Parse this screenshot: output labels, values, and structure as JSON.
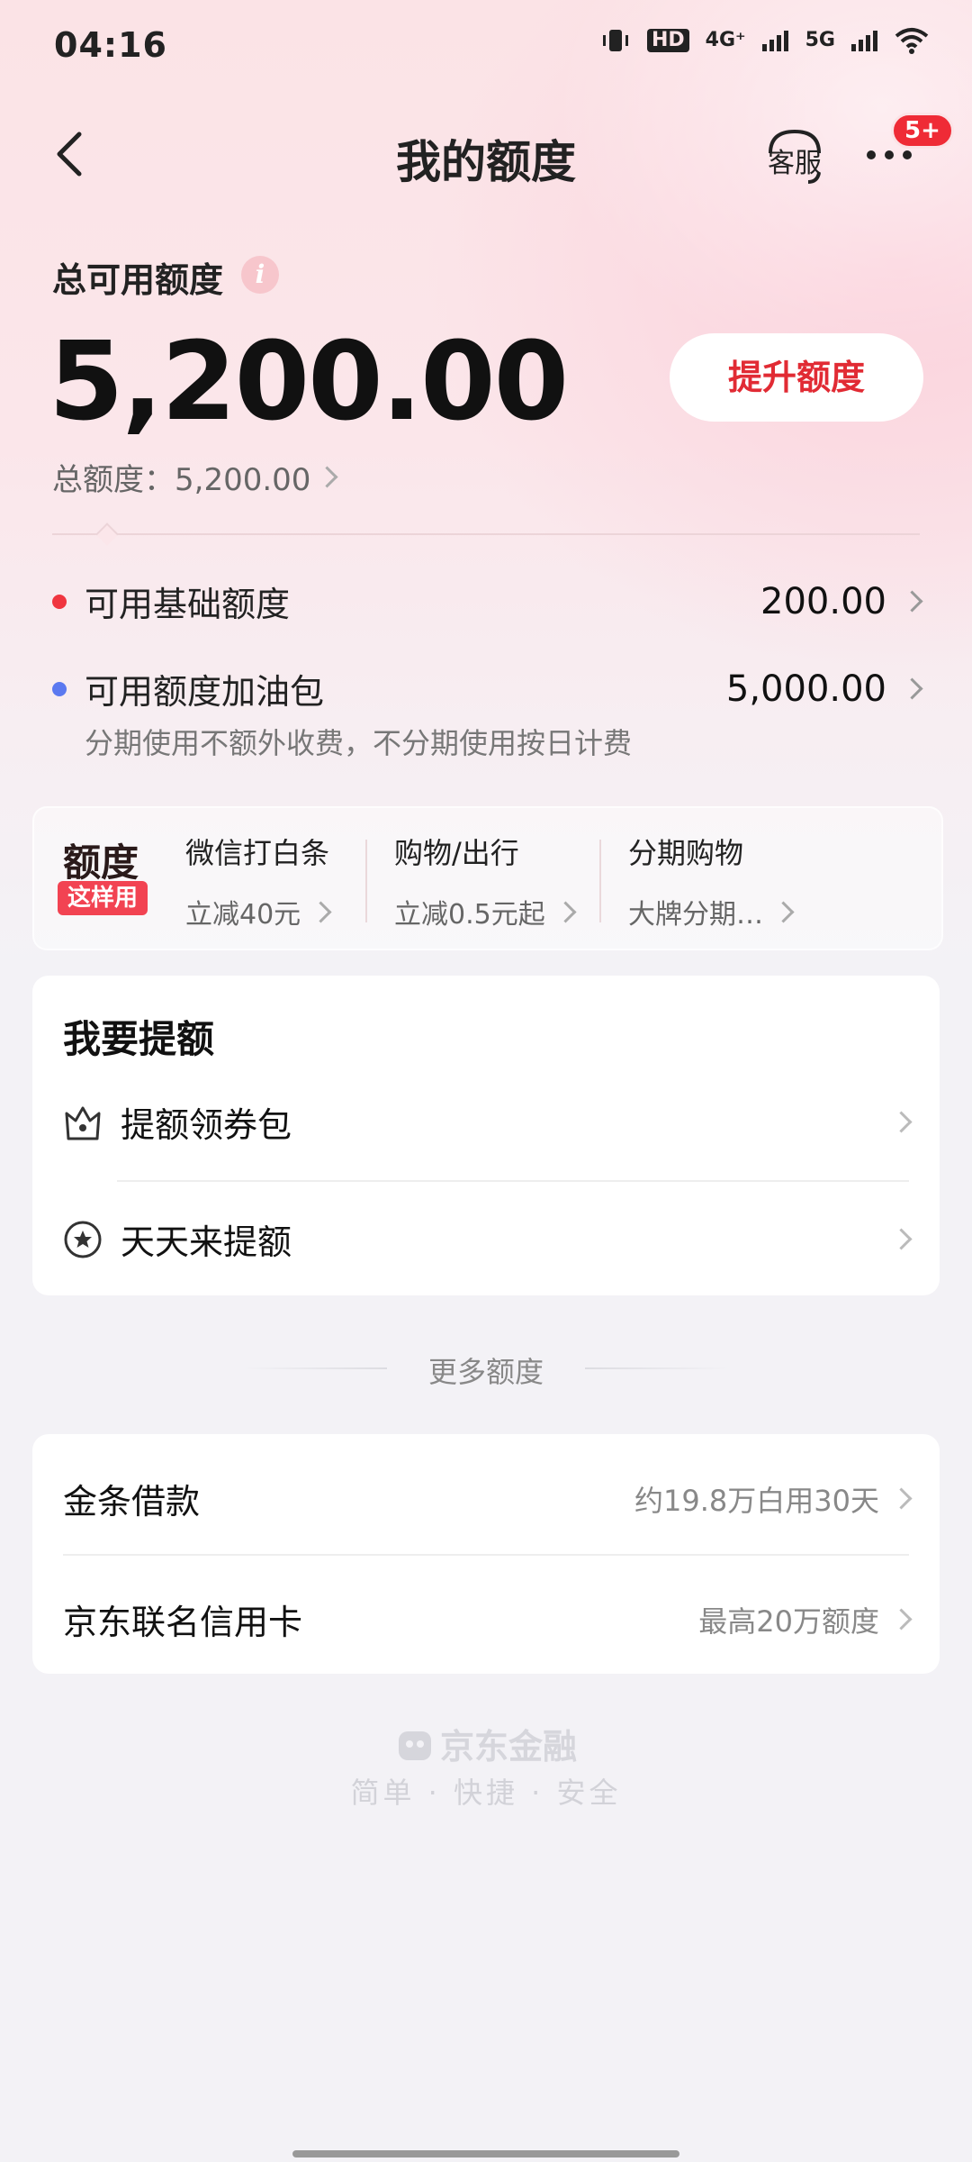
{
  "status_bar": {
    "time": "04:16",
    "hd_label": "HD",
    "net1": "4G⁺",
    "net2": "5G"
  },
  "nav": {
    "title": "我的额度",
    "service_label": "客服",
    "badge": "5+"
  },
  "summary": {
    "label": "总可用额度",
    "info_glyph": "i",
    "amount": "5,200.00",
    "raise_button": "提升额度",
    "total_text": "总额度：5,200.00"
  },
  "details": [
    {
      "label": "可用基础额度",
      "value": "200.00",
      "dot_color": "#f0353f"
    },
    {
      "label": "可用额度加油包",
      "value": "5,000.00",
      "dot_color": "#5b79f0"
    }
  ],
  "details_note": "分期使用不额外收费，不分期使用按日计费",
  "promo": {
    "title": "额度",
    "tag": "这样用",
    "items": [
      {
        "title": "微信打白条",
        "sub": "立减40元"
      },
      {
        "title": "购物/出行",
        "sub": "立减0.5元起"
      },
      {
        "title": "分期购物",
        "sub": "大牌分期…"
      }
    ]
  },
  "raise_section": {
    "title": "我要提额",
    "items": [
      {
        "label": "提额领券包",
        "icon": "crown-icon"
      },
      {
        "label": "天天来提额",
        "icon": "star-circle-icon"
      }
    ]
  },
  "more_label": "更多额度",
  "more_items": [
    {
      "label": "金条借款",
      "value": "约19.8万白用30天"
    },
    {
      "label": "京东联名信用卡",
      "value": "最高20万额度"
    }
  ],
  "footer": {
    "brand": "京东金融",
    "slogan": "简单 · 快捷 · 安全"
  }
}
